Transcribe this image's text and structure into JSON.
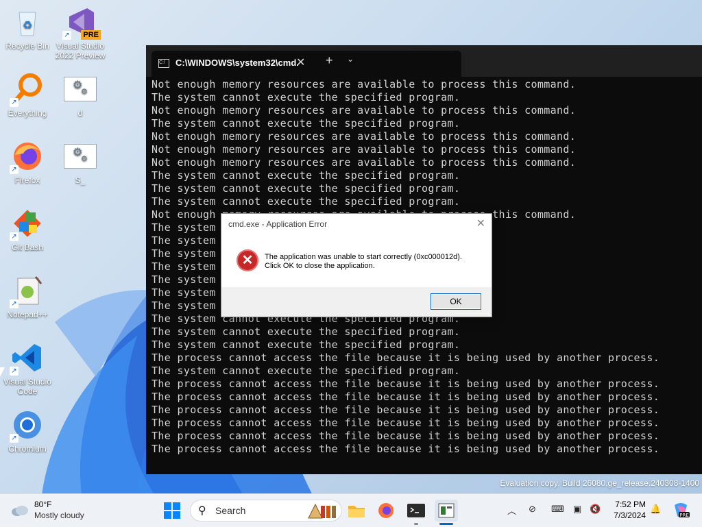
{
  "desktop": {
    "icons": [
      {
        "label": "Recycle Bin",
        "icon": "recycle-bin-icon"
      },
      {
        "label": "Visual Studio 2022 Preview",
        "icon": "visual-studio-preview-icon",
        "badge": "PRE"
      },
      {
        "label": "Everything",
        "icon": "everything-search-icon"
      },
      {
        "label": "d",
        "icon": "settings-file-icon"
      },
      {
        "label": "Firefox",
        "icon": "firefox-icon"
      },
      {
        "label": "S_",
        "icon": "settings-file-icon"
      },
      {
        "label": "Git Bash",
        "icon": "git-bash-icon"
      },
      {
        "label": "Notepad++",
        "icon": "notepadpp-icon"
      },
      {
        "label": "Visual Studio Code",
        "icon": "vscode-icon"
      },
      {
        "label": "Chromium",
        "icon": "chromium-icon"
      }
    ]
  },
  "console": {
    "tab_title": "C:\\WINDOWS\\system32\\cmd.",
    "new_tab": "+",
    "dropdown": "⌄",
    "close_tab": "✕",
    "output": "Not enough memory resources are available to process this command.\nThe system cannot execute the specified program.\nNot enough memory resources are available to process this command.\nThe system cannot execute the specified program.\nNot enough memory resources are available to process this command.\nNot enough memory resources are available to process this command.\nNot enough memory resources are available to process this command.\nThe system cannot execute the specified program.\nThe system cannot execute the specified program.\nThe system cannot execute the specified program.\nNot enough memory resources are available to process this command.\nThe system cannot execute the specified program.\nThe system cannot execute the specified program.\nThe system cannot execute the specified program.\nThe system cannot execute the specified program.\nThe system cannot execute the specified program.\nThe system cannot execute the specified program.\nThe system cannot execute the specified program.\nThe system cannot execute the specified program.\nThe system cannot execute the specified program.\nThe system cannot execute the specified program.\nThe process cannot access the file because it is being used by another process.\nThe system cannot execute the specified program.\nThe process cannot access the file because it is being used by another process.\nThe process cannot access the file because it is being used by another process.\nThe process cannot access the file because it is being used by another process.\nThe process cannot access the file because it is being used by another process.\nThe process cannot access the file because it is being used by another process.\nThe process cannot access the file because it is being used by another process."
  },
  "dialog": {
    "title": "cmd.exe - Application Error",
    "message_line1": "The application was unable to start correctly (0xc000012d).",
    "message_line2": "Click OK to close the application.",
    "ok_label": "OK",
    "close_glyph": "✕"
  },
  "watermark": "Evaluation copy. Build 26080.ge_release.240308-1400",
  "taskbar": {
    "weather_temp": "80°F",
    "weather_condition": "Mostly cloudy",
    "search_placeholder": "Search",
    "time": "7:52 PM",
    "date": "7/3/2024"
  }
}
